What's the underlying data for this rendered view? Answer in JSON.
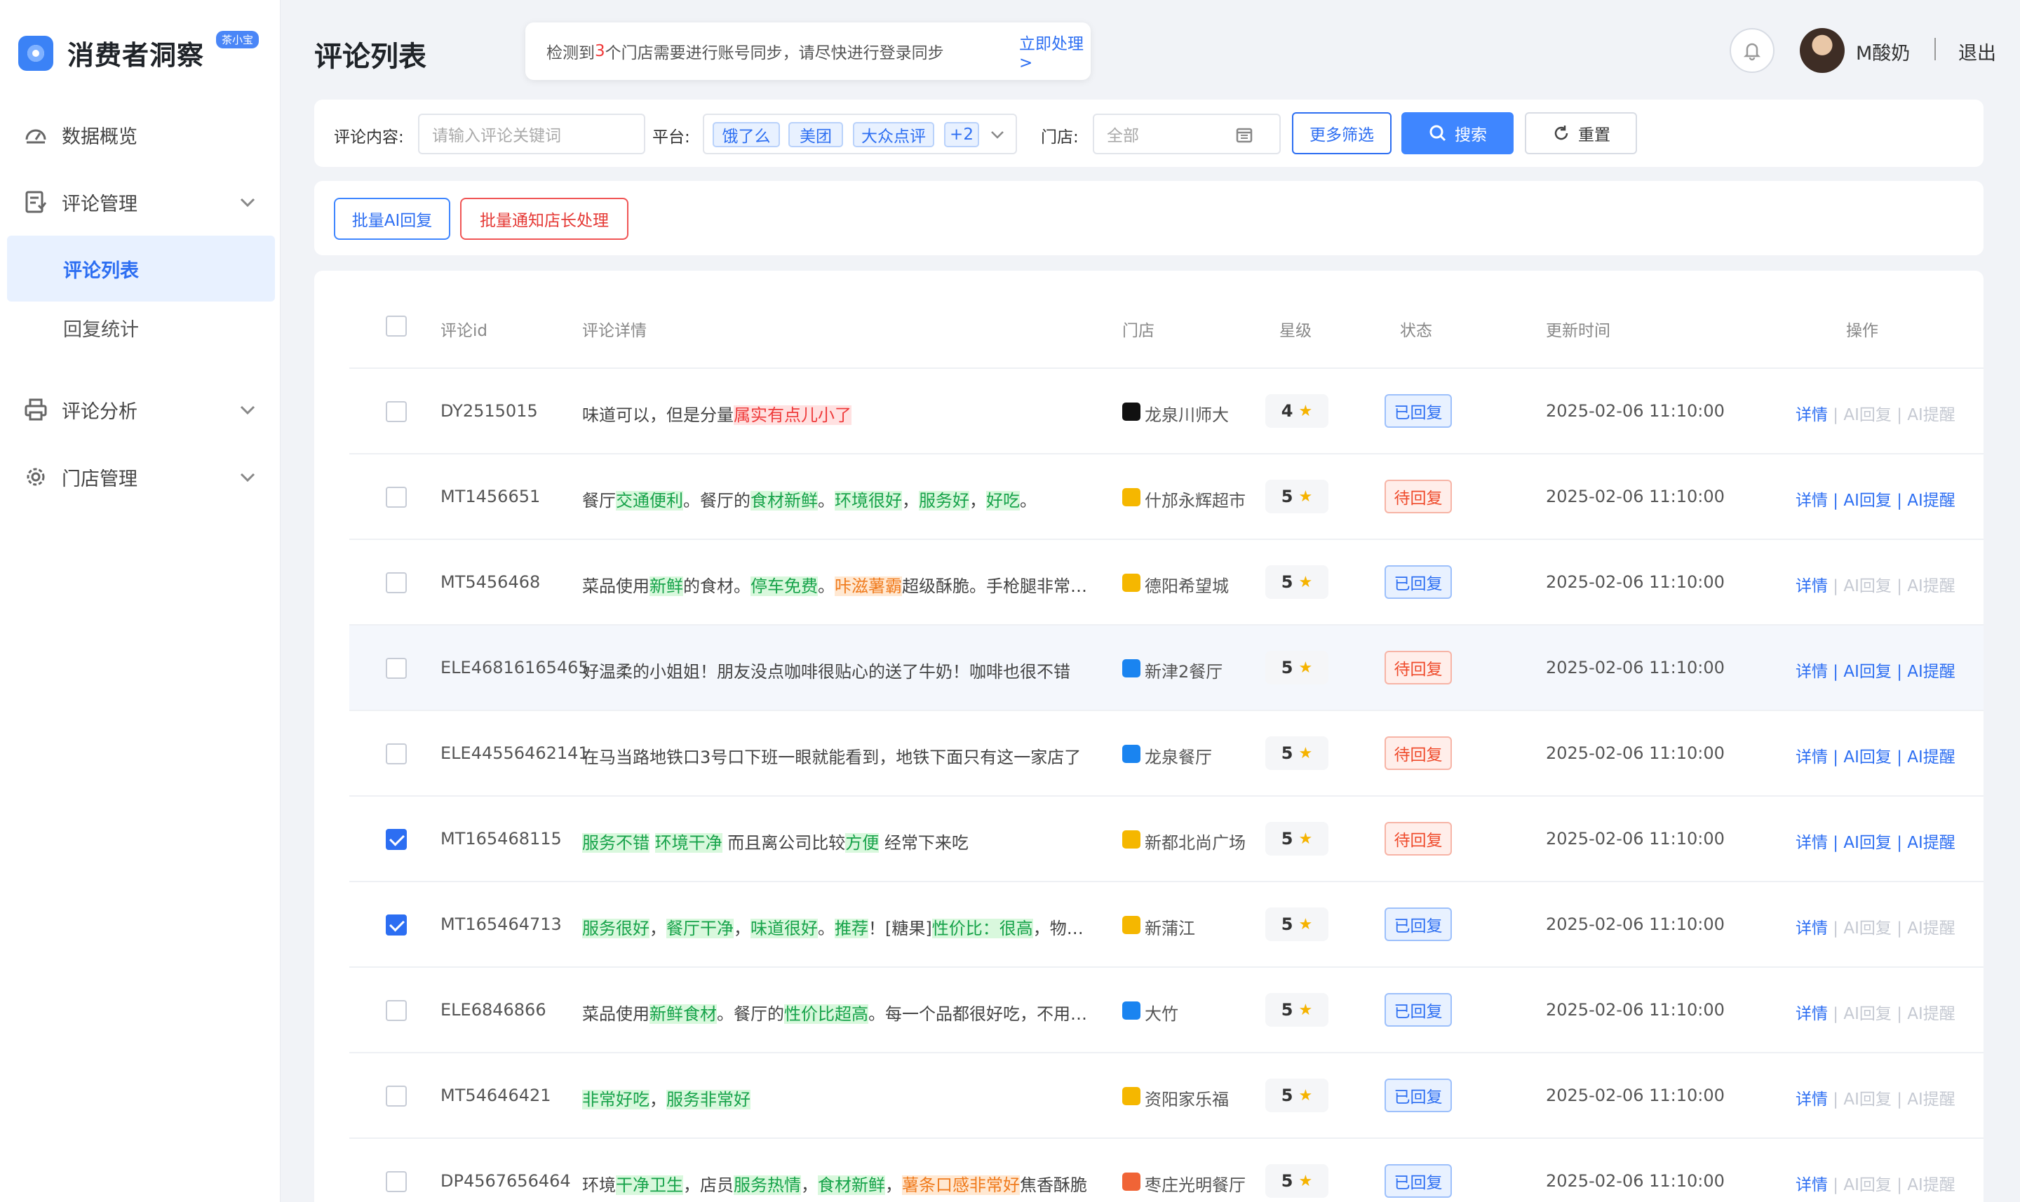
{
  "app": {
    "name": "消费者洞察",
    "badge": "茶小宝"
  },
  "sidebar": {
    "items": [
      {
        "label": "数据概览",
        "icon": "dashboard-icon"
      },
      {
        "label": "评论管理",
        "icon": "comment-manage-icon"
      },
      {
        "label": "评论列表"
      },
      {
        "label": "回复统计"
      },
      {
        "label": "评论分析",
        "icon": "printer-icon"
      },
      {
        "label": "门店管理",
        "icon": "gear-icon"
      }
    ]
  },
  "header": {
    "title": "评论列表",
    "notice_pre": "检测到",
    "notice_num": "3",
    "notice_post": "个门店需要进行账号同步，请尽快进行登录同步",
    "notice_link": "立即处理 >",
    "username": "M酸奶",
    "logout": "退出"
  },
  "filter": {
    "content_label": "评论内容:",
    "content_placeholder": "请输入评论关键词",
    "platform_label": "平台:",
    "platform_tags": [
      "饿了么",
      "美团",
      "大众点评",
      "+2"
    ],
    "store_label": "门店:",
    "store_value": "全部",
    "more": "更多筛选",
    "search": "搜索",
    "reset": "重置"
  },
  "actions": {
    "batch_ai": "批量AI回复",
    "batch_notify": "批量通知店长处理"
  },
  "table": {
    "headers": [
      "评论id",
      "评论详情",
      "门店",
      "星级",
      "状态",
      "更新时间",
      "操作"
    ],
    "op_labels": {
      "detail": "详情",
      "ai_reply": "AI回复",
      "ai_remind": "AI提醒",
      "sep": " | "
    },
    "rows": [
      {
        "id": "DY2515015",
        "detail": [
          [
            "味道可以，但是分量",
            ""
          ],
          [
            "属实有点儿小了",
            "r"
          ]
        ],
        "store": "龙泉川师大",
        "platform": "dy",
        "stars": "4",
        "status": "已回复",
        "time": "2025-02-06 11:10:00",
        "checked": false,
        "hl": false
      },
      {
        "id": "MT1456651",
        "detail": [
          [
            "餐厅",
            ""
          ],
          [
            "交通便利",
            "g"
          ],
          [
            "。餐厅的",
            ""
          ],
          [
            "食材新鲜",
            "g"
          ],
          [
            "。",
            ""
          ],
          [
            "环境很好",
            "g"
          ],
          [
            "，",
            ""
          ],
          [
            "服务好",
            "g"
          ],
          [
            "，",
            ""
          ],
          [
            "好吃",
            "g"
          ],
          [
            "。",
            ""
          ]
        ],
        "store": "什邡永辉超市",
        "platform": "mt",
        "stars": "5",
        "status": "待回复",
        "time": "2025-02-06 11:10:00",
        "checked": false,
        "hl": false
      },
      {
        "id": "MT5456468",
        "detail": [
          [
            "菜品使用",
            ""
          ],
          [
            "新鲜",
            "g"
          ],
          [
            "的食材。",
            ""
          ],
          [
            "停车免费",
            "g"
          ],
          [
            "。",
            ""
          ],
          [
            "咔滋薯霸",
            "o"
          ],
          [
            "超级酥脆。手枪腿非常好吃",
            ""
          ]
        ],
        "store": "德阳希望城",
        "platform": "mt",
        "stars": "5",
        "status": "已回复",
        "time": "2025-02-06 11:10:00",
        "checked": false,
        "hl": false
      },
      {
        "id": "ELE46816165465",
        "detail": [
          [
            "好温柔的小姐姐！朋友没点咖啡很贴心的送了牛奶！咖啡也很不错",
            ""
          ]
        ],
        "store": "新津2餐厅",
        "platform": "ele",
        "stars": "5",
        "status": "待回复",
        "time": "2025-02-06 11:10:00",
        "checked": false,
        "hl": true
      },
      {
        "id": "ELE44556462141",
        "detail": [
          [
            "在马当路地铁口3号口下班一眼就能看到，地铁下面只有这一家店了",
            ""
          ]
        ],
        "store": "龙泉餐厅",
        "platform": "ele",
        "stars": "5",
        "status": "待回复",
        "time": "2025-02-06 11:10:00",
        "checked": false,
        "hl": false
      },
      {
        "id": "MT165468115",
        "detail": [
          [
            "服务不错",
            "g"
          ],
          [
            " ",
            ""
          ],
          [
            "环境干净",
            "g"
          ],
          [
            " 而且离公司比较",
            ""
          ],
          [
            "方便",
            "g"
          ],
          [
            " 经常下来吃",
            ""
          ]
        ],
        "store": "新都北尚广场",
        "platform": "mt",
        "stars": "5",
        "status": "待回复",
        "time": "2025-02-06 11:10:00",
        "checked": true,
        "hl": false
      },
      {
        "id": "MT165464713",
        "detail": [
          [
            "服务很好",
            "g"
          ],
          [
            "，",
            ""
          ],
          [
            "餐厅干净",
            "g"
          ],
          [
            "，",
            ""
          ],
          [
            "味道很好",
            "g"
          ],
          [
            "。",
            ""
          ],
          [
            "推荐",
            "g"
          ],
          [
            "！[糖果]",
            ""
          ],
          [
            "性价比：很高",
            "g"
          ],
          [
            "，物超所值",
            ""
          ]
        ],
        "store": "新蒲江",
        "platform": "mt",
        "stars": "5",
        "status": "已回复",
        "time": "2025-02-06 11:10:00",
        "checked": true,
        "hl": false
      },
      {
        "id": "ELE6846866",
        "detail": [
          [
            "菜品使用",
            ""
          ],
          [
            "新鲜食材",
            "g"
          ],
          [
            "。餐厅的",
            ""
          ],
          [
            "性价比超高",
            "g"
          ],
          [
            "。每一个品都很好吃，不用担心",
            ""
          ]
        ],
        "store": "大竹",
        "platform": "ele",
        "stars": "5",
        "status": "已回复",
        "time": "2025-02-06 11:10:00",
        "checked": false,
        "hl": false
      },
      {
        "id": "MT54646421",
        "detail": [
          [
            "非常好吃",
            "g"
          ],
          [
            "，",
            ""
          ],
          [
            "服务非常好",
            "g"
          ]
        ],
        "store": "资阳家乐福",
        "platform": "mt",
        "stars": "5",
        "status": "已回复",
        "time": "2025-02-06 11:10:00",
        "checked": false,
        "hl": false
      },
      {
        "id": "DP4567656464",
        "detail": [
          [
            "环境",
            ""
          ],
          [
            "干净卫生",
            "g"
          ],
          [
            "，店员",
            ""
          ],
          [
            "服务热情",
            "g"
          ],
          [
            "，",
            ""
          ],
          [
            "食材新鲜",
            "g"
          ],
          [
            "，",
            ""
          ],
          [
            "薯条口感非常好",
            "o"
          ],
          [
            "焦香酥脆",
            ""
          ]
        ],
        "store": "枣庄光明餐厅",
        "platform": "dp",
        "stars": "5",
        "status": "已回复",
        "time": "2025-02-06 11:10:00",
        "checked": false,
        "hl": false
      }
    ]
  },
  "colors": {
    "primary": "#2c6ef2",
    "positive": "#17a34a",
    "negative": "#ef3b3b",
    "warn": "#f07b1d"
  }
}
